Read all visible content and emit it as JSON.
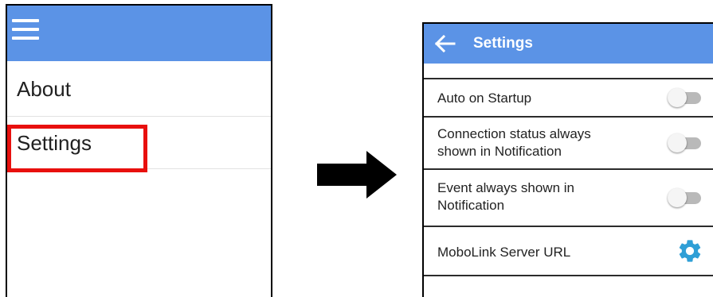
{
  "left_panel": {
    "menu_icon": "hamburger-menu-icon",
    "items": [
      {
        "label": "About"
      },
      {
        "label": "Settings"
      }
    ],
    "highlight_color": "#e8100e"
  },
  "arrow_icon": "right-arrow-icon",
  "right_panel": {
    "title": "Settings",
    "back_icon": "back-arrow-icon",
    "settings": [
      {
        "label_lines": [
          "Auto on Startup"
        ],
        "control": "toggle",
        "state": "off"
      },
      {
        "label_lines": [
          "Connection status always",
          "shown in Notification"
        ],
        "control": "toggle",
        "state": "off"
      },
      {
        "label_lines": [
          "Event always shown in",
          "Notification"
        ],
        "control": "toggle",
        "state": "off"
      },
      {
        "label_lines": [
          "MoboLink Server URL"
        ],
        "control": "gear-icon"
      }
    ]
  },
  "colors": {
    "header": "#5b93e6",
    "gear": "#2f9fd6",
    "toggle_off_track": "#b9b9b9"
  }
}
